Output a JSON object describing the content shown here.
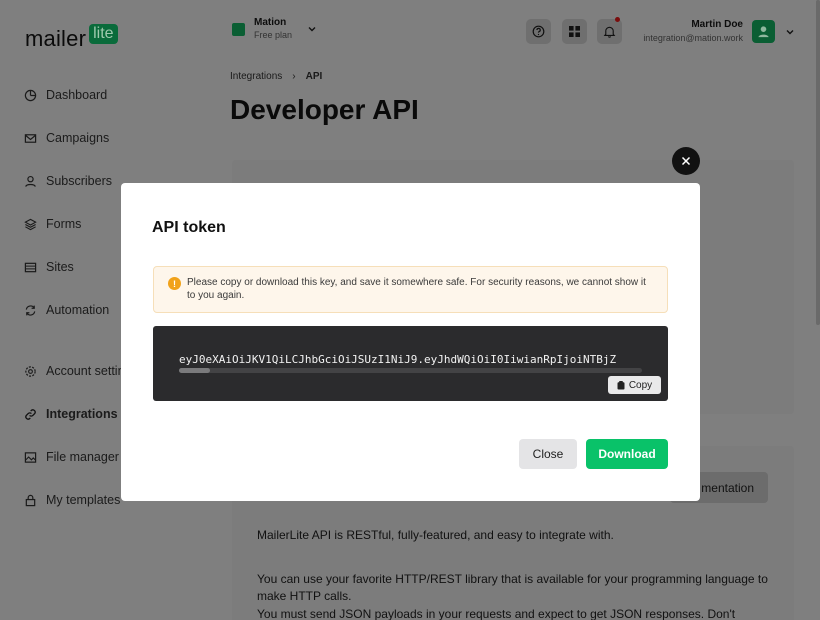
{
  "brand": {
    "logo_main": "mailer",
    "logo_badge": "lite"
  },
  "sidebar": {
    "items": [
      {
        "label": "Dashboard",
        "icon": "dashboard-icon"
      },
      {
        "label": "Campaigns",
        "icon": "mail-icon"
      },
      {
        "label": "Subscribers",
        "icon": "user-icon"
      },
      {
        "label": "Forms",
        "icon": "layers-icon"
      },
      {
        "label": "Sites",
        "icon": "browser-icon"
      },
      {
        "label": "Automation",
        "icon": "refresh-icon"
      },
      {
        "label": "Account settings",
        "icon": "gear-icon"
      },
      {
        "label": "Integrations",
        "icon": "link-icon",
        "active": true
      },
      {
        "label": "File manager",
        "icon": "image-icon"
      },
      {
        "label": "My templates",
        "icon": "lock-icon"
      }
    ]
  },
  "header": {
    "workspace_name": "Mation",
    "workspace_plan": "Free plan",
    "user_name": "Martin Doe",
    "user_email": "integration@mation.work"
  },
  "breadcrumb": {
    "parent": "Integrations",
    "separator": "›",
    "current": "API"
  },
  "page": {
    "title": "Developer API",
    "docs_button": "mentation",
    "para1": "MailerLite API is RESTful, fully-featured, and easy to integrate with.",
    "para2": "You can use your favorite HTTP/REST library that is available for your programming language to make HTTP calls.",
    "para3": "You must send JSON payloads in your requests and expect to get JSON responses. Don't"
  },
  "modal": {
    "title": "API token",
    "alert": "Please copy or download this key, and save it somewhere safe. For security reasons, we cannot show it to you again.",
    "token": "eyJ0eXAiOiJKV1QiLCJhbGciOiJSUzI1NiJ9.eyJhdWQiOiI0IiwianRpIjoiNTBjZ",
    "copy_label": "Copy",
    "close_label": "Close",
    "download_label": "Download"
  },
  "colors": {
    "brand_green": "#09c269",
    "dark_green": "#0a5e33",
    "overlay": "#7f7f7f"
  }
}
